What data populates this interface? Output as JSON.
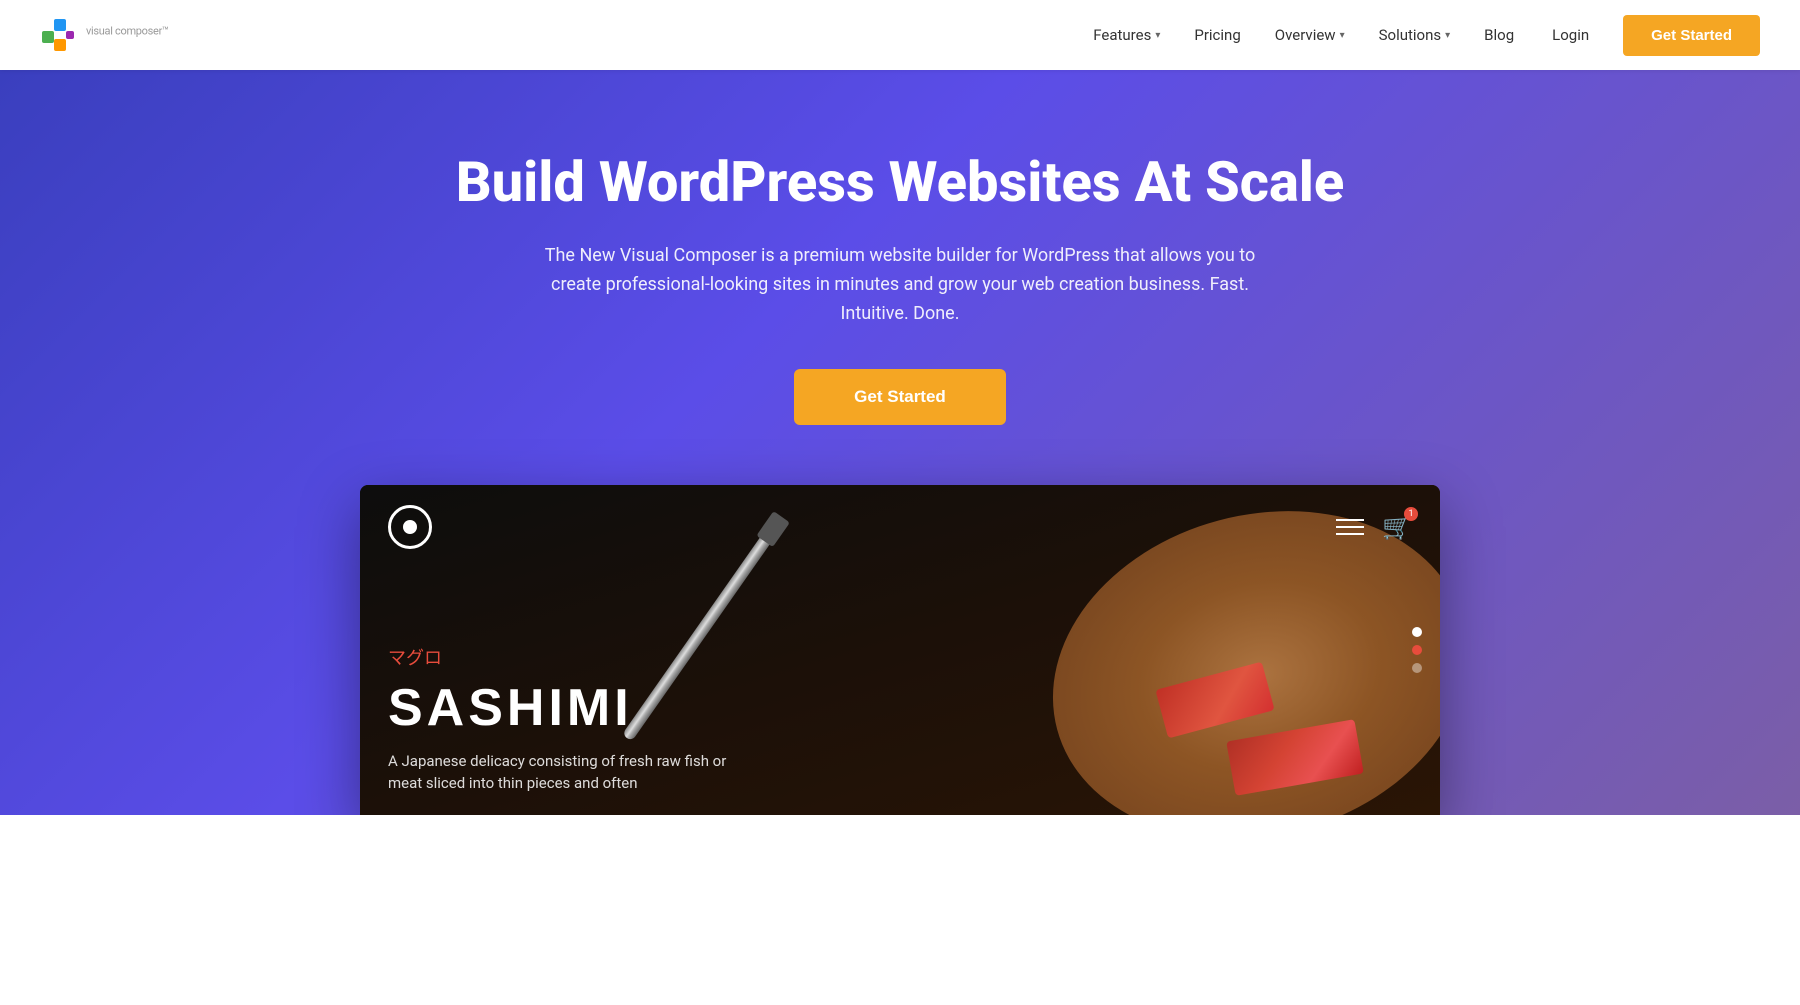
{
  "header": {
    "logo_text": "visual composer",
    "logo_tm": "™",
    "nav": [
      {
        "id": "features",
        "label": "Features",
        "has_dropdown": true
      },
      {
        "id": "pricing",
        "label": "Pricing",
        "has_dropdown": false
      },
      {
        "id": "overview",
        "label": "Overview",
        "has_dropdown": true
      },
      {
        "id": "solutions",
        "label": "Solutions",
        "has_dropdown": true
      },
      {
        "id": "blog",
        "label": "Blog",
        "has_dropdown": false
      }
    ],
    "login_label": "Login",
    "cta_label": "Get Started"
  },
  "hero": {
    "title": "Build WordPress Websites At Scale",
    "subtitle": "The New Visual Composer is a premium website builder for WordPress that allows you to create professional-looking sites in minutes and grow your web creation business. Fast. Intuitive. Done.",
    "cta_label": "Get Started"
  },
  "preview": {
    "sashimi_jp": "マグロ",
    "sashimi_title": "SASHIMI",
    "sashimi_desc": "A Japanese delicacy consisting of fresh raw fish or meat sliced into thin pieces and often",
    "slider_dots": [
      {
        "state": "active"
      },
      {
        "state": "red"
      },
      {
        "state": "default"
      }
    ]
  },
  "colors": {
    "hero_gradient_start": "#3a3fbe",
    "hero_gradient_end": "#7b5ea7",
    "cta_orange": "#f5a623",
    "accent_red": "#e74c3c"
  }
}
